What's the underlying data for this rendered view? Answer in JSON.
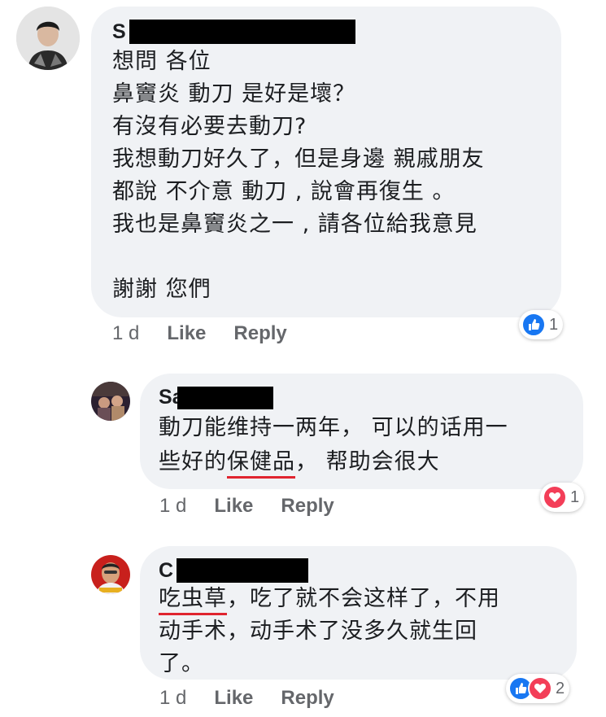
{
  "comments": [
    {
      "name_initial": "S",
      "lines": [
        "想問 各位",
        "鼻竇炎 動刀 是好是壞？",
        "有沒有必要去動刀?",
        "我想動刀好久了，但是身邊 親戚朋友",
        "都說 不介意 動刀 , 說會再復生 。",
        "我也是鼻竇炎之一 , 請各位給我意見",
        "",
        "謝謝 您們"
      ],
      "time": "1 d",
      "like_label": "Like",
      "reply_label": "Reply",
      "reaction_count": "1"
    },
    {
      "name_initial": "Sa",
      "line1": "動刀能维持一两年， 可以的话用一",
      "line2_pre": "些好的",
      "line2_highlight": "保健品",
      "line2_post": "， 帮助会很大",
      "time": "1 d",
      "like_label": "Like",
      "reply_label": "Reply",
      "reaction_count": "1"
    },
    {
      "name_initial": "C",
      "line1_highlight": "吃虫草",
      "line1_post": "，吃了就不会这样了，不用",
      "line2": "动手术，动手术了没多久就生回",
      "line3": "了。",
      "time": "1 d",
      "like_label": "Like",
      "reply_label": "Reply",
      "reaction_count": "2"
    }
  ],
  "colors": {
    "bubble": "#f0f2f5",
    "like_blue": "#1877f2",
    "love_red": "#f33e58",
    "underline_red": "#e0242f",
    "meta_gray": "#65676b"
  },
  "icons": [
    "like-reaction-icon",
    "love-reaction-icon"
  ]
}
